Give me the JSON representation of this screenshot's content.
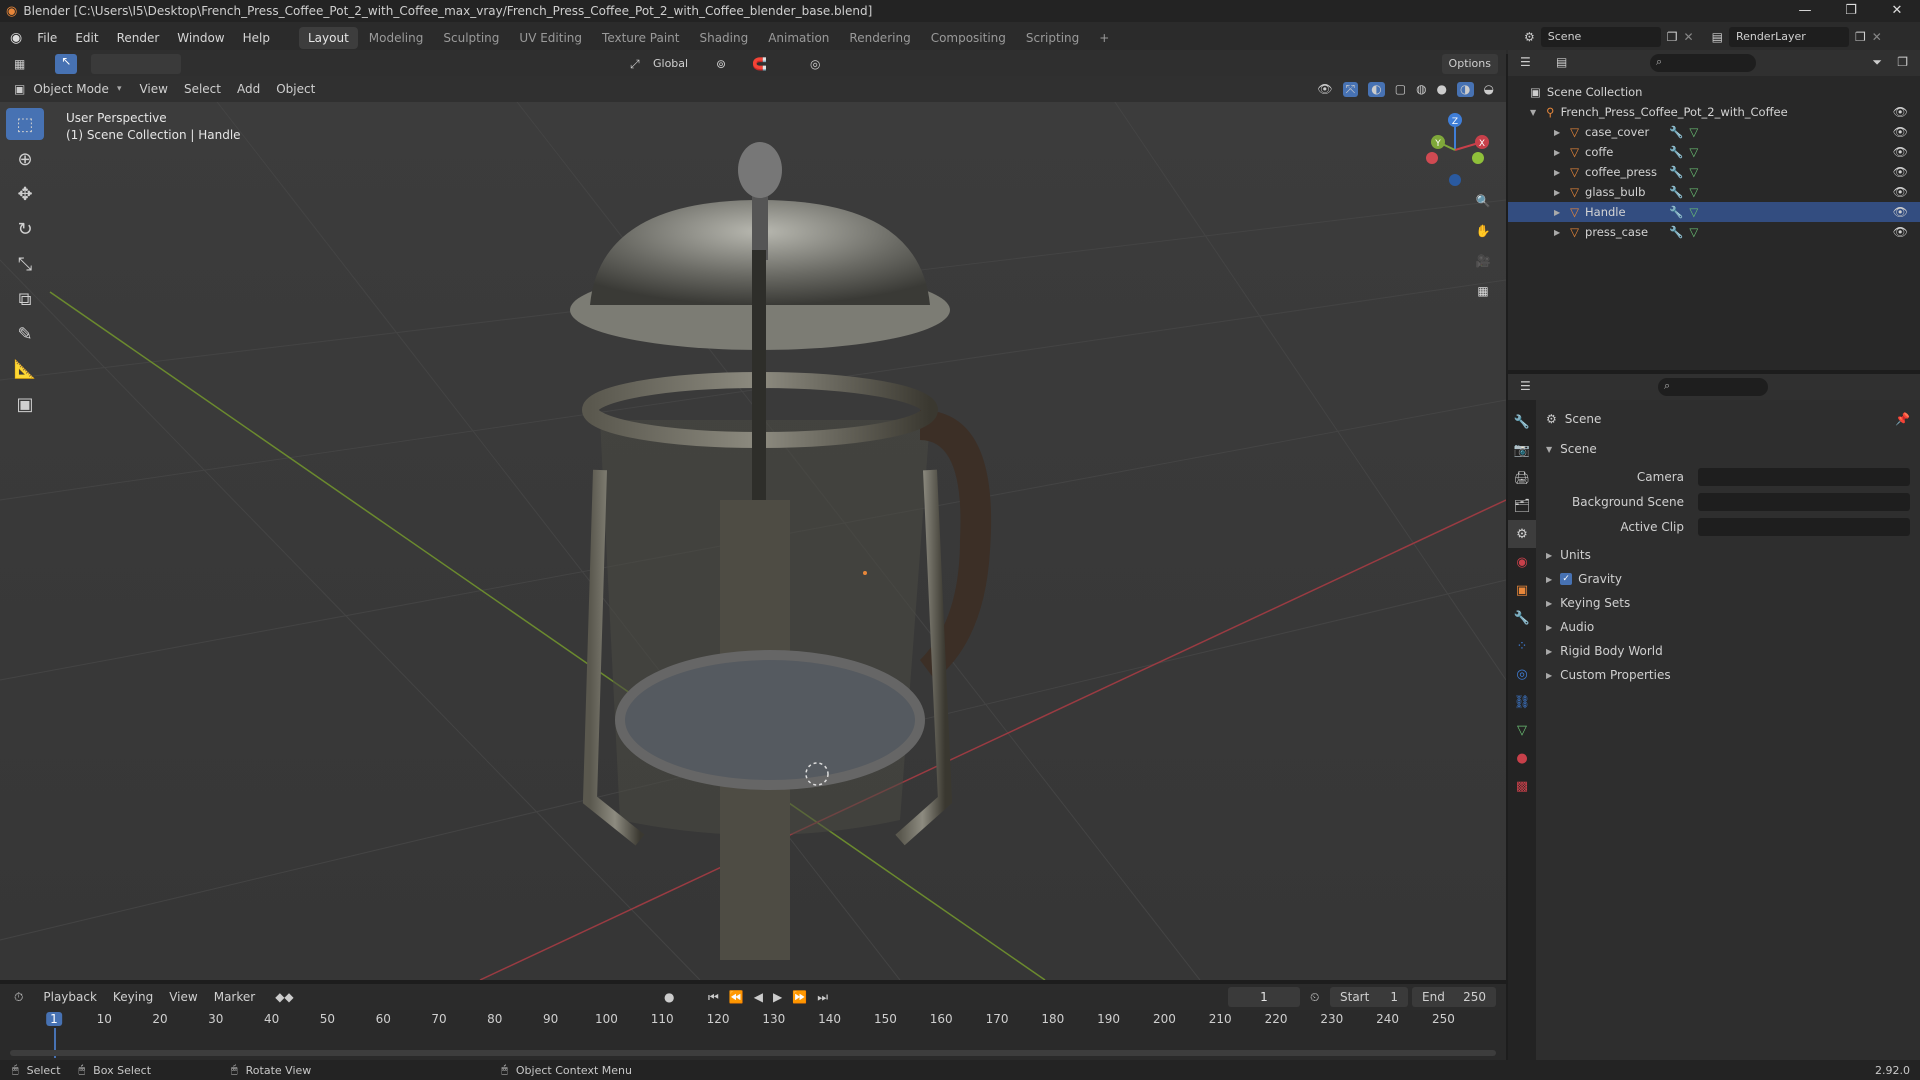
{
  "window": {
    "title": "Blender [C:\\Users\\I5\\Desktop\\French_Press_Coffee_Pot_2_with_Coffee_max_vray/French_Press_Coffee_Pot_2_with_Coffee_blender_base.blend]"
  },
  "menu": [
    "File",
    "Edit",
    "Render",
    "Window",
    "Help"
  ],
  "workspaces": [
    "Layout",
    "Modeling",
    "Sculpting",
    "UV Editing",
    "Texture Paint",
    "Shading",
    "Animation",
    "Rendering",
    "Compositing",
    "Scripting"
  ],
  "active_workspace": "Layout",
  "scene_selector": "Scene",
  "renderlayer_selector": "RenderLayer",
  "tool_header": {
    "transform_orientation": "Global",
    "options_label": "Options"
  },
  "viewport_header": {
    "mode": "Object Mode",
    "menus": [
      "View",
      "Select",
      "Add",
      "Object"
    ]
  },
  "viewport": {
    "info_line1": "User Perspective",
    "info_line2": "(1) Scene Collection | Handle",
    "gizmo_axes": [
      "Z",
      "Y",
      "X"
    ]
  },
  "outliner": {
    "root": "Scene Collection",
    "collection": "French_Press_Coffee_Pot_2_with_Coffee",
    "objects": [
      "case_cover",
      "coffe",
      "coffee_press",
      "glass_bulb",
      "Handle",
      "press_case"
    ]
  },
  "properties": {
    "context": "Scene",
    "panel_title": "Scene",
    "fields": [
      {
        "label": "Camera"
      },
      {
        "label": "Background Scene"
      },
      {
        "label": "Active Clip"
      }
    ],
    "subpanels": [
      "Units",
      "Gravity",
      "Keying Sets",
      "Audio",
      "Rigid Body World",
      "Custom Properties"
    ],
    "gravity_checked": true
  },
  "timeline": {
    "menus": [
      "Playback",
      "Keying",
      "View",
      "Marker"
    ],
    "current_frame": "1",
    "start_label": "Start",
    "start_value": "1",
    "end_label": "End",
    "end_value": "250",
    "ticks": [
      "1",
      "10",
      "20",
      "30",
      "40",
      "50",
      "60",
      "70",
      "80",
      "90",
      "100",
      "110",
      "120",
      "130",
      "140",
      "150",
      "160",
      "170",
      "180",
      "190",
      "200",
      "210",
      "220",
      "230",
      "240",
      "250"
    ]
  },
  "statusbar": {
    "select": "Select",
    "box_select": "Box Select",
    "rotate_view": "Rotate View",
    "context_menu": "Object Context Menu",
    "version": "2.92.0"
  },
  "colors": {
    "accent": "#4772b3",
    "x_axis": "#c8404a",
    "y_axis": "#7fa83a",
    "z_axis": "#3f7ed8",
    "object_orange": "#e8873a",
    "mesh_green": "#6bbf74"
  }
}
